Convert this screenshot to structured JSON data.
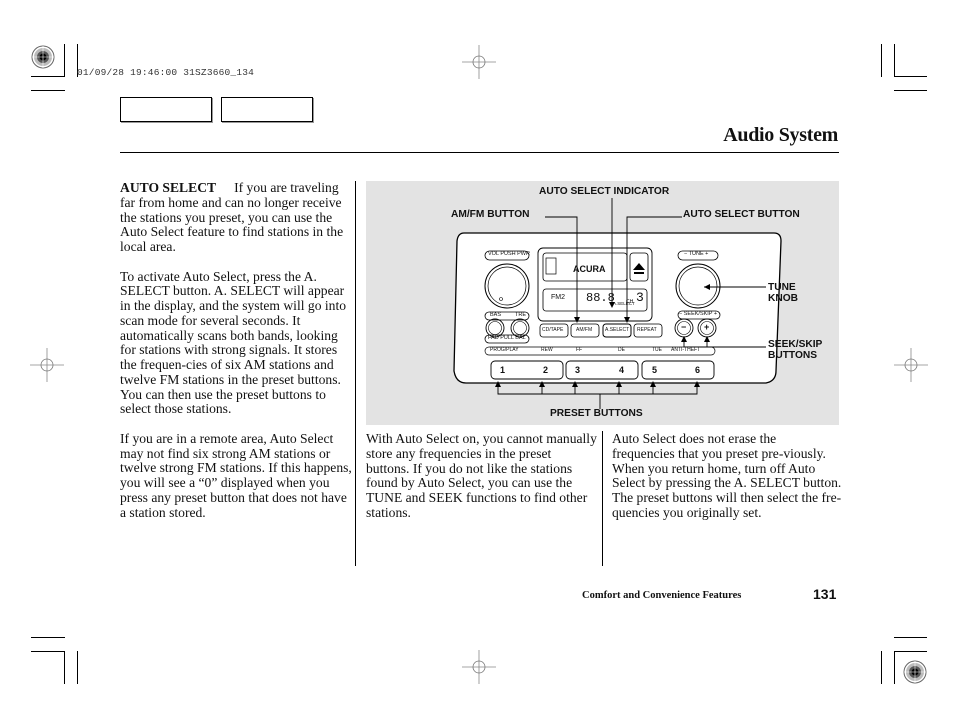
{
  "print_stamp": "01/09/28 19:46:00 31SZ3660_134",
  "header": {
    "title": "Audio System",
    "tab_boxes": [
      "",
      ""
    ]
  },
  "left_column": {
    "lead": "AUTO SELECT",
    "paragraphs": [
      "If you are traveling far from home and can no longer receive the stations you preset, you can use the Auto Select feature to find stations in the local area.",
      "To activate Auto Select, press the A. SELECT button. A. SELECT will appear in the display, and the system will go into scan mode for several seconds. It automatically scans both bands, looking for stations with strong signals. It stores the frequen-cies of six AM stations and twelve FM stations in the preset buttons. You can then use the preset buttons to select those stations.",
      "If you are in a remote area, Auto Select may not find six strong AM stations or twelve strong FM stations. If this happens, you will see a “0” displayed when you press any preset button that does not have a station stored."
    ]
  },
  "figure": {
    "callouts": {
      "auto_select_indicator": "AUTO SELECT INDICATOR",
      "am_fm_button": "AM/FM BUTTON",
      "auto_select_button": "AUTO SELECT BUTTON",
      "tune_knob_1": "TUNE",
      "tune_knob_2": "KNOB",
      "seek_skip_1": "SEEK/SKIP",
      "seek_skip_2": "BUTTONS",
      "preset_buttons": "PRESET BUTTONS"
    },
    "radio": {
      "brand": "ACURA",
      "vol_label": "VOL PUSH PWR",
      "bass_label": "BAS",
      "treble_label": "TRE",
      "fader_label": "FAD PULL BAL",
      "tune_label": "− TUNE +",
      "seek_label": "− SEEK/SKIP +",
      "display_band": "FM2",
      "display_freq": "88.8",
      "display_indicator": "A.SELECT",
      "display_ch": "CH",
      "display_ch_num": "3",
      "function_buttons": [
        "CD/TAPE",
        "AM/FM",
        "A.SELECT",
        "REPEAT"
      ],
      "function_strip": [
        "PROG/PLAY",
        "REW",
        "FF",
        "DE",
        "TUE",
        "ANTI-THEFT"
      ],
      "preset_numbers": [
        "1",
        "2",
        "3",
        "4",
        "5",
        "6"
      ],
      "seek_minus": "−",
      "seek_plus": "+"
    }
  },
  "middle_column": {
    "paragraph": "With Auto Select on, you cannot manually store any frequencies in the preset buttons. If you do not like the stations found by Auto Select, you can use the TUNE and SEEK functions to find other stations."
  },
  "right_column": {
    "paragraph": "Auto Select does not erase the frequencies that you preset pre-viously. When you return home, turn off Auto Select by pressing the A. SELECT button. The preset buttons will then select the fre-quencies you originally set."
  },
  "footer": {
    "section": "Comfort and Convenience Features",
    "page_number": "131"
  }
}
